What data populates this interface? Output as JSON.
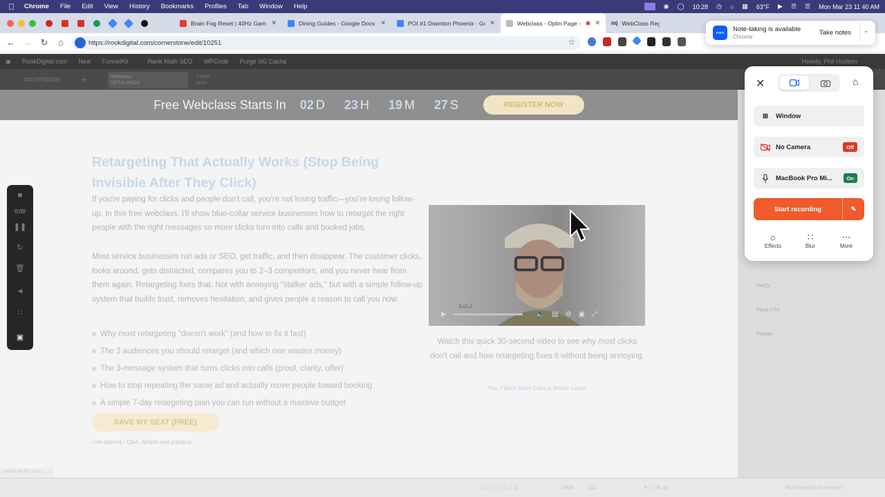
{
  "menubar": {
    "app": "Chrome",
    "items": [
      "File",
      "Edit",
      "View",
      "History",
      "Bookmarks",
      "Profiles",
      "Tab",
      "Window",
      "Help"
    ],
    "time_left": "10:28",
    "weather": "63°F",
    "datetime": "Mon Mar 23  11 40 AM"
  },
  "tabs": [
    {
      "title": "Brain Fog Reset | 40Hz Gam",
      "fav": "#e53935"
    },
    {
      "title": "Dining Guides - Google Docs",
      "fav": "#4285f4"
    },
    {
      "title": "POI #1 Downton Phoenix - Go",
      "fav": "#4285f4"
    },
    {
      "title": "Webclass - Optin Page - ",
      "fav": "#9e9e9e"
    },
    {
      "title": "WebClass Regist",
      "fav": "#333333"
    }
  ],
  "address": {
    "url": "https://rookdigital.com/cornerstone/edit/10251"
  },
  "wpbar": {
    "items": [
      "RookDigital.com",
      "New",
      "FunnelKit",
      "Rank Math SEO",
      "WPCode",
      "Purge SG Cache"
    ],
    "howdy": "Howdy, Phil Hudson"
  },
  "cornerstone": {
    "logo": "cornerstone",
    "tab_line1": "Webclass",
    "tab_line2": "OPTIN PAGE",
    "tab2_line1": "Footer",
    "tab2_line2": "Area"
  },
  "countdown": {
    "label": "Free Webclass Starts In",
    "days": "02",
    "days_unit": "D",
    "hours": "23",
    "hours_unit": "H",
    "minutes": "19",
    "minutes_unit": "M",
    "seconds": "27",
    "seconds_unit": "S",
    "button": "REGISTER NOW"
  },
  "page": {
    "headline": "Retargeting That Actually Works (Stop Being Invisible After They Click)",
    "para1": "If you're paying for clicks and people don't call, you're not losing traffic—you're losing follow-up. In this free webclass, I'll show blue-collar service businesses how to retarget the right people with the right messages so more clicks turn into calls and booked jobs.",
    "para2": "Most service businesses run ads or SEO, get traffic, and then disappear. The customer clicks, looks around, gets distracted, compares you to 2–3 competitors, and you never hear from them again. Retargeting fixes that. Not with annoying \"stalker ads,\" but with a simple follow-up system that builds trust, removes hesitation, and gives people a reason to call you now.",
    "bullets": [
      "Why most retargeting \"doesn't work\" (and how to fix it fast)",
      "The 3 audiences you should retarget (and which one wastes money)",
      "The 3-message system that turns clicks into calls (proof, clarity, offer)",
      "How to stop repeating the same ad and actually move people toward booking",
      "A simple 7-day retargeting plan you can run without a massive budget"
    ],
    "cta": "SAVE MY SEAT (FREE)",
    "subcta": "Live training • Q&A. Simple and practical.",
    "video_time": "00:29",
    "video_caption": "Watch this quick 30-second video to see why most clicks don't call and how retargeting fixes it without being annoying.",
    "video_link": "Yes, I Want More Calls & Better Leads"
  },
  "sidebar": {
    "items": [
      "FAQs",
      "Final CTA",
      "Footer"
    ]
  },
  "bottombar": {
    "zoom": "1600",
    "percent": "100",
    "hint": "Hide Section Formatter",
    "what": "What You'll Learn"
  },
  "zoom_panel": {
    "time": "0:00"
  },
  "recorder": {
    "window_label": "Window",
    "camera_label": "No Camera",
    "camera_state": "Off",
    "mic_label": "MacBook Pro Mi...",
    "mic_state": "On",
    "start": "Start recording",
    "options": [
      "Effects",
      "Blur",
      "More"
    ]
  },
  "notification": {
    "title": "Note-taking is available",
    "sub": "Chrome",
    "button": "Take notes",
    "icon_text": "zoom"
  },
  "colors": {
    "accent": "#f15a2b",
    "off": "#e0362c",
    "on": "#1e7c4e",
    "menubar": "#3b3a78"
  }
}
